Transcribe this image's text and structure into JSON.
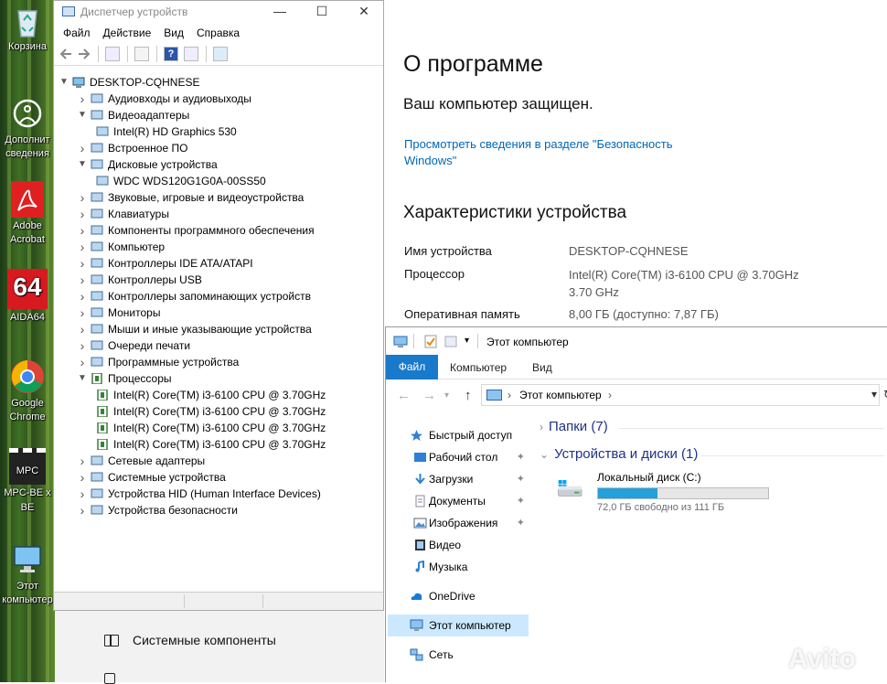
{
  "desktop": {
    "icons": [
      {
        "label": "Корзина",
        "icon": "recycle-bin-icon"
      },
      {
        "label": "Дополнит",
        "label2": "сведения",
        "icon": "info-circle-icon"
      },
      {
        "label": "Adobe",
        "label2": "Acrobat",
        "icon": "adobe-acrobat-icon"
      },
      {
        "label": "AIDA64",
        "badge": "64",
        "icon": "aida64-icon"
      },
      {
        "label": "Google",
        "label2": "Chrome",
        "icon": "chrome-icon"
      },
      {
        "label": "MPC-BE x",
        "badge": "MPC BE",
        "icon": "mpc-be-icon"
      },
      {
        "label": "Этот",
        "label2": "компьютер",
        "icon": "this-pc-icon"
      }
    ]
  },
  "settings": {
    "title": "О программе",
    "protected": "Ваш компьютер защищен.",
    "link": "Просмотреть сведения в разделе \"Безопасность Windows\"",
    "specs_title": "Характеристики устройства",
    "specs": [
      {
        "label": "Имя устройства",
        "value": "DESKTOP-CQHNESE"
      },
      {
        "label": "Процессор",
        "value": "Intel(R) Core(TM) i3-6100 CPU @ 3.70GHz",
        "value2": "3.70 GHz"
      },
      {
        "label": "Оперативная память",
        "value": "8,00 ГБ (доступно: 7,87 ГБ)"
      }
    ],
    "bottom_item": "Системные компоненты"
  },
  "devmgr": {
    "title": "Диспетчер устройств",
    "window_buttons": {
      "minimize": "—",
      "maximize": "☐",
      "close": "✕"
    },
    "menu": [
      "Файл",
      "Действие",
      "Вид",
      "Справка"
    ],
    "root": "DESKTOP-CQHNESE",
    "nodes": [
      {
        "label": "Аудиовходы и аудиовыходы",
        "expanded": false,
        "icon": "speaker-icon"
      },
      {
        "label": "Видеоадаптеры",
        "expanded": true,
        "icon": "display-adapter-icon"
      },
      {
        "label": "Intel(R) HD Graphics 530",
        "child": true,
        "icon": "display-adapter-icon"
      },
      {
        "label": "Встроенное ПО",
        "expanded": false,
        "icon": "firmware-icon"
      },
      {
        "label": "Дисковые устройства",
        "expanded": true,
        "icon": "disk-drive-icon"
      },
      {
        "label": "WDC WDS120G1G0A-00SS50",
        "child": true,
        "icon": "disk-drive-icon"
      },
      {
        "label": "Звуковые, игровые и видеоустройства",
        "expanded": false,
        "icon": "sound-icon"
      },
      {
        "label": "Клавиатуры",
        "expanded": false,
        "icon": "keyboard-icon"
      },
      {
        "label": "Компоненты программного обеспечения",
        "expanded": false,
        "icon": "software-component-icon"
      },
      {
        "label": "Компьютер",
        "expanded": false,
        "icon": "computer-icon"
      },
      {
        "label": "Контроллеры IDE ATA/ATAPI",
        "expanded": false,
        "icon": "ide-controller-icon"
      },
      {
        "label": "Контроллеры USB",
        "expanded": false,
        "icon": "usb-icon"
      },
      {
        "label": "Контроллеры запоминающих устройств",
        "expanded": false,
        "icon": "storage-controller-icon"
      },
      {
        "label": "Мониторы",
        "expanded": false,
        "icon": "monitor-icon"
      },
      {
        "label": "Мыши и иные указывающие устройства",
        "expanded": false,
        "icon": "mouse-icon"
      },
      {
        "label": "Очереди печати",
        "expanded": false,
        "icon": "printer-icon"
      },
      {
        "label": "Программные устройства",
        "expanded": false,
        "icon": "software-device-icon"
      },
      {
        "label": "Процессоры",
        "expanded": true,
        "icon": "processor-icon"
      },
      {
        "label": "Intel(R) Core(TM) i3-6100 CPU @ 3.70GHz",
        "child": true,
        "icon": "processor-icon"
      },
      {
        "label": "Intel(R) Core(TM) i3-6100 CPU @ 3.70GHz",
        "child": true,
        "icon": "processor-icon"
      },
      {
        "label": "Intel(R) Core(TM) i3-6100 CPU @ 3.70GHz",
        "child": true,
        "icon": "processor-icon"
      },
      {
        "label": "Intel(R) Core(TM) i3-6100 CPU @ 3.70GHz",
        "child": true,
        "icon": "processor-icon"
      },
      {
        "label": "Сетевые адаптеры",
        "expanded": false,
        "icon": "network-adapter-icon"
      },
      {
        "label": "Системные устройства",
        "expanded": false,
        "icon": "system-device-icon"
      },
      {
        "label": "Устройства HID (Human Interface Devices)",
        "expanded": false,
        "icon": "hid-icon"
      },
      {
        "label": "Устройства безопасности",
        "expanded": false,
        "icon": "security-device-icon"
      }
    ]
  },
  "explorer": {
    "title": "Этот компьютер",
    "tabs": {
      "file": "Файл",
      "computer": "Компьютер",
      "view": "Вид"
    },
    "address": "Этот компьютер",
    "nav": [
      {
        "label": "Быстрый доступ",
        "icon": "star-icon",
        "top": true
      },
      {
        "label": "Рабочий стол",
        "icon": "desktop-folder-icon",
        "pinned": true
      },
      {
        "label": "Загрузки",
        "icon": "download-icon",
        "pinned": true
      },
      {
        "label": "Документы",
        "icon": "documents-icon",
        "pinned": true
      },
      {
        "label": "Изображения",
        "icon": "pictures-icon",
        "pinned": true
      },
      {
        "label": "Видео",
        "icon": "video-icon"
      },
      {
        "label": "Музыка",
        "icon": "music-icon"
      },
      {
        "label": "OneDrive",
        "icon": "onedrive-icon",
        "top": true
      },
      {
        "label": "Этот компьютер",
        "icon": "this-pc-icon",
        "top": true,
        "selected": true
      },
      {
        "label": "Сеть",
        "icon": "network-icon",
        "top": true
      }
    ],
    "groups": {
      "folders": "Папки (7)",
      "devices": "Устройства и диски (1)"
    },
    "drive": {
      "name": "Локальный диск (C:)",
      "free": "72,0 ГБ свободно из 111 ГБ",
      "used_fraction": 0.35
    }
  },
  "watermark": "Avito",
  "colors": {
    "accent": "#1979ca",
    "link": "#0067b8",
    "drive_bar": "#26a0da",
    "group_header": "#1e3287",
    "selection": "#cce8ff"
  }
}
